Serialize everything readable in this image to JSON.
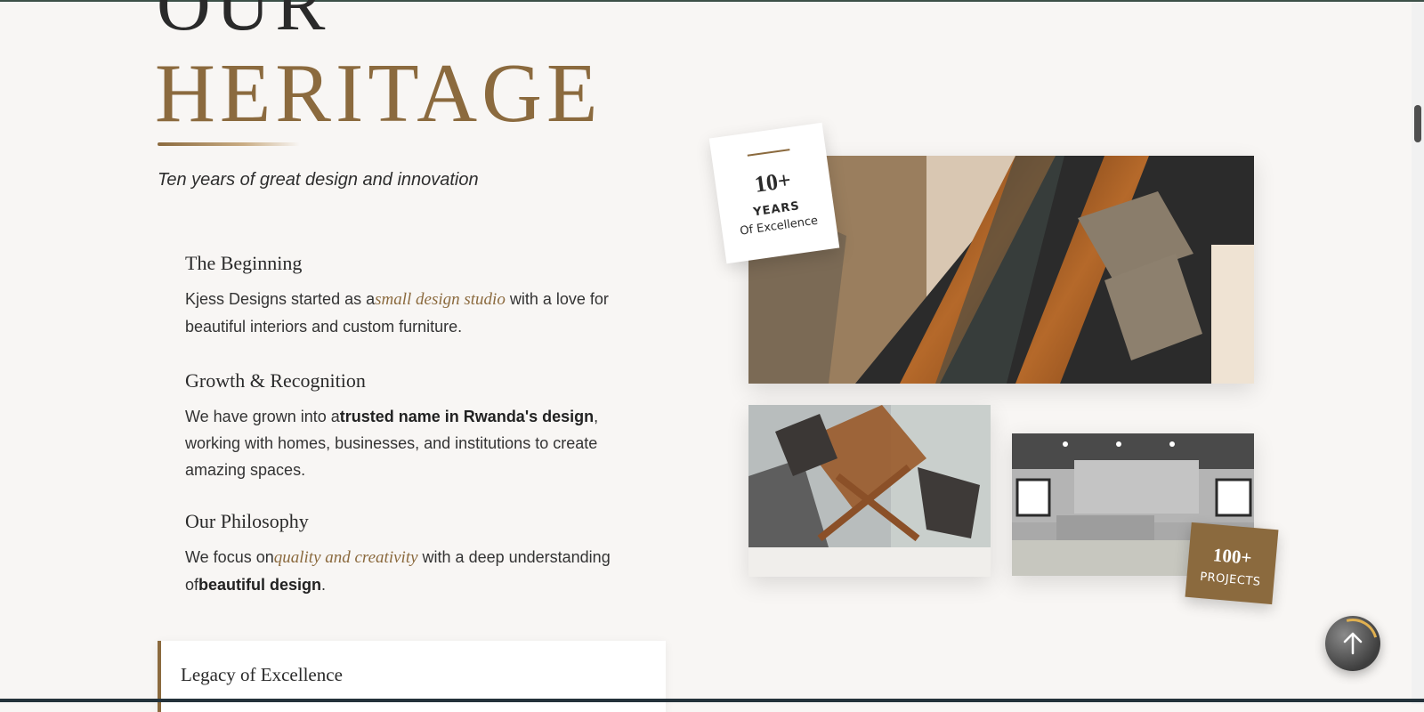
{
  "heading": {
    "line1": "OUR",
    "line2": "HERITAGE"
  },
  "subtitle": "Ten years of great design and innovation",
  "sections": [
    {
      "title": "The Beginning",
      "p1": "Kjess Designs started as a",
      "accent": "small design studio",
      "p2": " with a love for beautiful interiors and custom furniture."
    },
    {
      "title": "Growth & Recognition",
      "p1": "We have grown into a",
      "strong": "trusted name in Rwanda's design",
      "p2": ", working with homes, businesses, and institutions to create amazing spaces."
    },
    {
      "title": "Our Philosophy",
      "p1": "We focus on",
      "accent": "quality and creativity",
      "p2": " with a deep understanding of",
      "strong": "beautiful design",
      "p3": "."
    }
  ],
  "legacy": {
    "title": "Legacy of Excellence"
  },
  "badges": {
    "years": {
      "number": "10+",
      "label1": "YEARS",
      "label2": "Of Excellence"
    },
    "projects": {
      "number": "100+",
      "label": "PROJECTS"
    }
  },
  "colors": {
    "accent": "#8b6a3e",
    "background": "#f8f6f4",
    "text": "#2d2d2d"
  },
  "icons": {
    "scroll_top": "arrow-up-icon"
  }
}
